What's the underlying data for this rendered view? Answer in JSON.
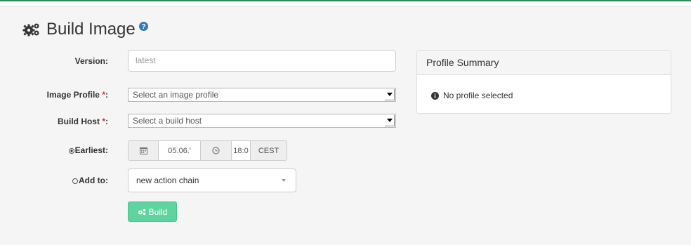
{
  "page": {
    "title": "Build Image"
  },
  "form": {
    "version": {
      "label": "Version:",
      "value": "latest"
    },
    "image_profile": {
      "label": "Image Profile",
      "required_mark": "*",
      "colon": ":",
      "selected": "Select an image profile"
    },
    "build_host": {
      "label": "Build Host",
      "required_mark": "*",
      "colon": ":",
      "selected": "Select a build host"
    },
    "earliest": {
      "label": "Earliest:",
      "date": "05.06.'",
      "time": "18:0",
      "timezone": "CEST"
    },
    "add_to": {
      "label": "Add to:",
      "selected": "new action chain"
    },
    "build_button": {
      "label": "Build"
    }
  },
  "profile_summary": {
    "title": "Profile Summary",
    "message": "No profile selected"
  },
  "colors": {
    "accent": "#5fd3a0",
    "required": "#c9302c",
    "top_line": "#2e8b57"
  },
  "icons": [
    "gears-icon",
    "help-icon",
    "calendar-icon",
    "clock-icon",
    "info-icon",
    "chevron-down-icon"
  ]
}
